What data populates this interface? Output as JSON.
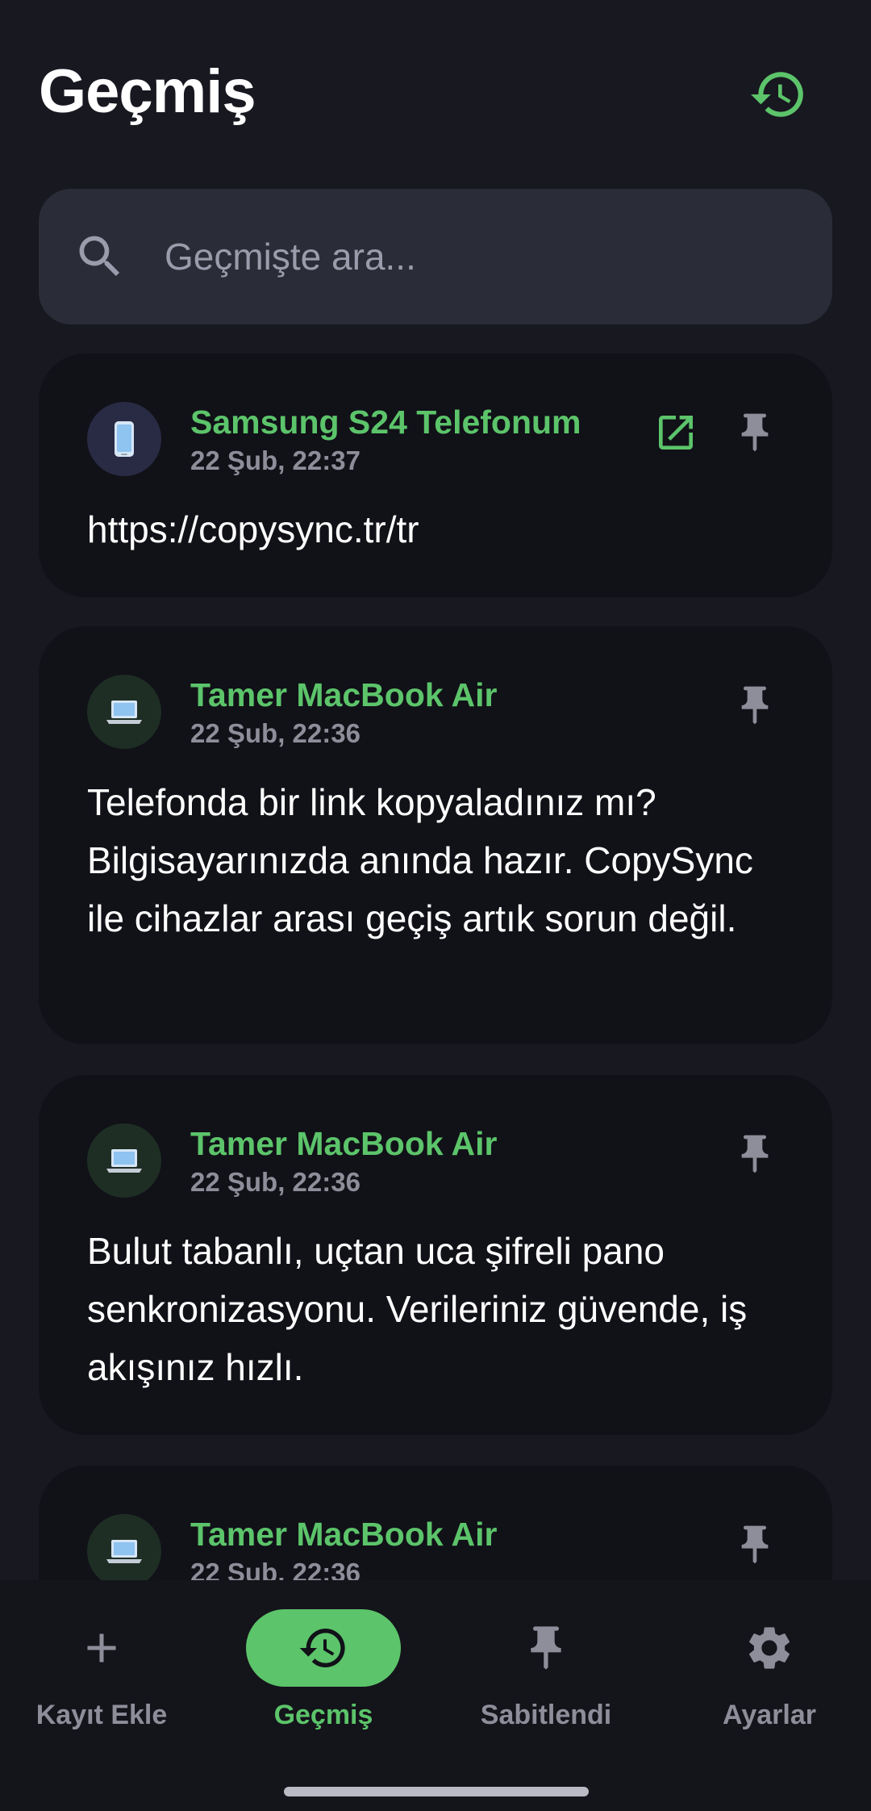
{
  "header": {
    "title": "Geçmiş",
    "history_icon": "history-icon"
  },
  "search": {
    "placeholder": "Geçmişte ara...",
    "value": "",
    "icon": "search-icon"
  },
  "items": [
    {
      "device": "Samsung S24 Telefonum",
      "device_type": "phone",
      "date": "22 Şub, 22:37",
      "text": "https://copysync.tr/tr",
      "has_open_link": true
    },
    {
      "device": "Tamer MacBook Air",
      "device_type": "laptop",
      "date": "22 Şub, 22:36",
      "text": "Telefonda bir link kopyaladınız mı? Bilgisayarınızda anında hazır. CopySync ile cihazlar arası geçiş artık sorun değil.",
      "has_open_link": false
    },
    {
      "device": "Tamer MacBook Air",
      "device_type": "laptop",
      "date": "22 Şub, 22:36",
      "text": "Bulut tabanlı, uçtan uca şifreli pano senkronizasyonu. Verileriniz güvende, iş akışınız hızlı.",
      "has_open_link": false
    },
    {
      "device": "Tamer MacBook Air",
      "device_type": "laptop",
      "date": "22 Şub, 22:36",
      "text": "",
      "has_open_link": false
    }
  ],
  "nav": [
    {
      "label": "Kayıt Ekle",
      "icon": "plus-icon",
      "active": false
    },
    {
      "label": "Geçmiş",
      "icon": "history-icon",
      "active": true
    },
    {
      "label": "Sabitlendi",
      "icon": "pin-icon",
      "active": false
    },
    {
      "label": "Ayarlar",
      "icon": "gear-icon",
      "active": false
    }
  ],
  "colors": {
    "accent": "#5cc46a",
    "background": "#181820",
    "card": "#111118",
    "search": "#2a2c37",
    "muted": "#8d8e99"
  }
}
